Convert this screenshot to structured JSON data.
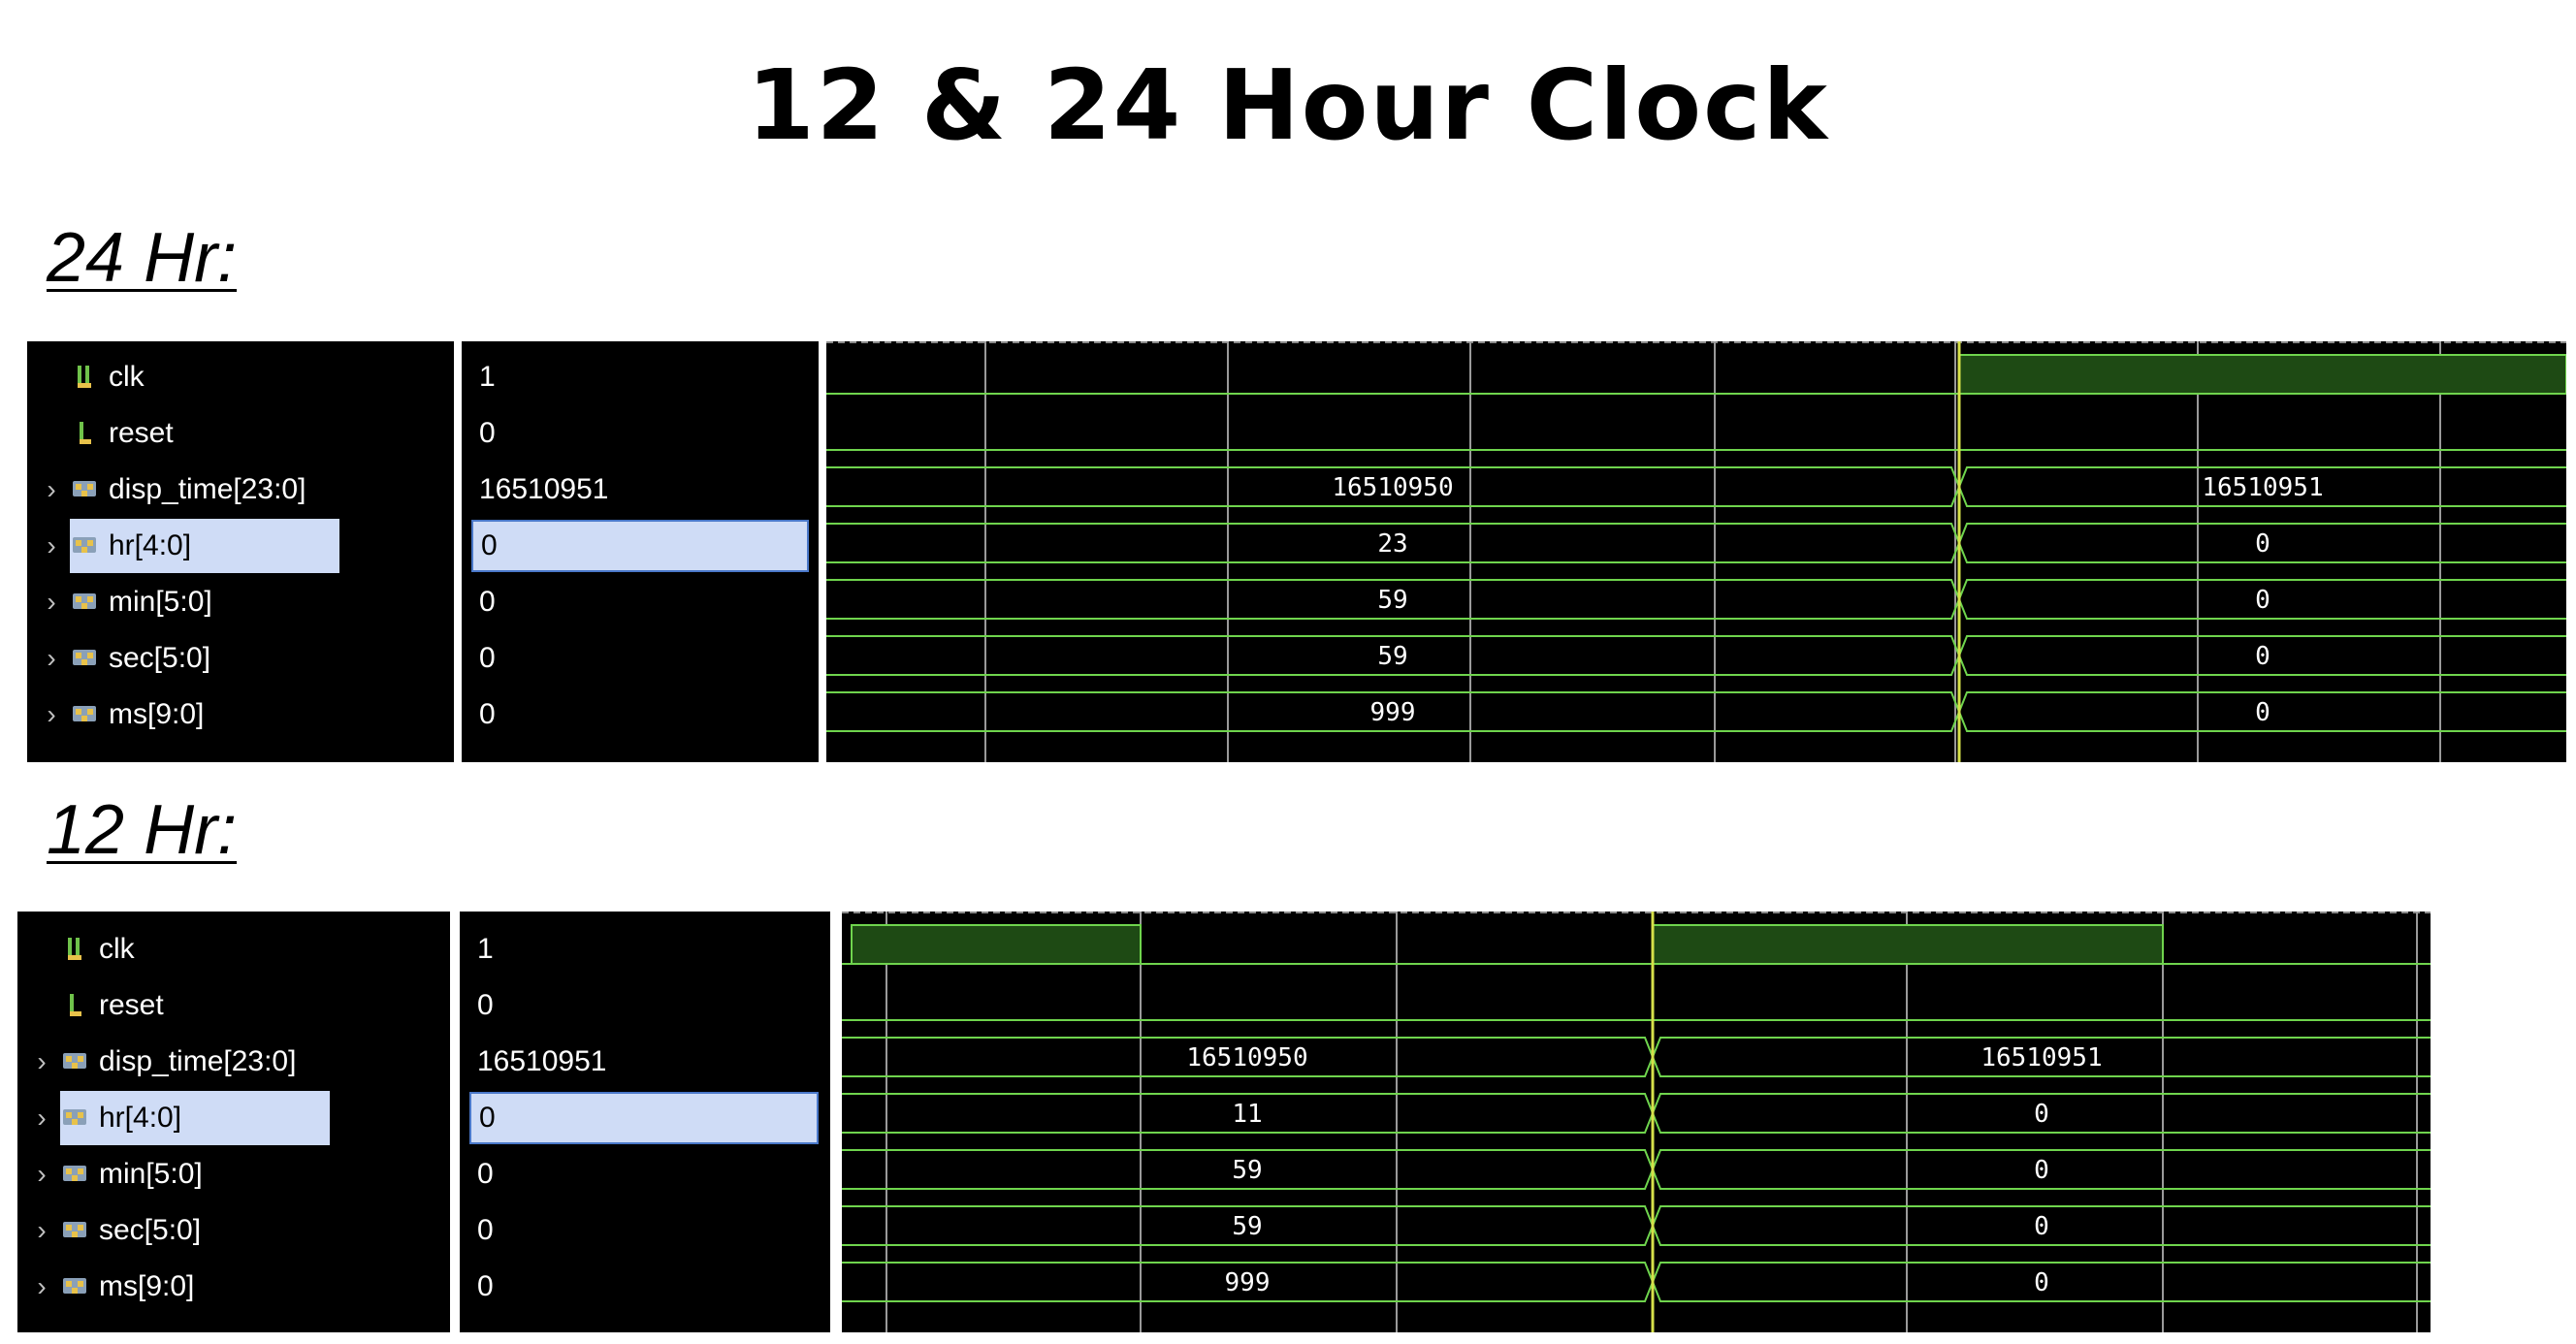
{
  "title": "12 & 24 Hour Clock",
  "colors": {
    "wave": "#6fd44d",
    "fill": "#1e4a14",
    "cursor": "#d6e04a",
    "grid": "#9a9a9a",
    "select": "#cfdcf6"
  },
  "sections": [
    {
      "label": "24 Hr:",
      "signals": [
        {
          "name": "clk",
          "value": "1",
          "icon": "clock-bit-icon",
          "expandable": false
        },
        {
          "name": "reset",
          "value": "0",
          "icon": "bit-icon",
          "expandable": false
        },
        {
          "name": "disp_time[23:0]",
          "value": "16510951",
          "icon": "bus-icon",
          "expandable": true,
          "before": "16510950",
          "after": "16510951"
        },
        {
          "name": "hr[4:0]",
          "value": "0",
          "icon": "bus-icon",
          "expandable": true,
          "selected": true,
          "before": "23",
          "after": "0"
        },
        {
          "name": "min[5:0]",
          "value": "0",
          "icon": "bus-icon",
          "expandable": true,
          "before": "59",
          "after": "0"
        },
        {
          "name": "sec[5:0]",
          "value": "0",
          "icon": "bus-icon",
          "expandable": true,
          "before": "59",
          "after": "0"
        },
        {
          "name": "ms[9:0]",
          "value": "0",
          "icon": "bus-icon",
          "expandable": true,
          "before": "999",
          "after": "0"
        }
      ]
    },
    {
      "label": "12 Hr:",
      "signals": [
        {
          "name": "clk",
          "value": "1",
          "icon": "clock-bit-icon",
          "expandable": false
        },
        {
          "name": "reset",
          "value": "0",
          "icon": "bit-icon",
          "expandable": false
        },
        {
          "name": "disp_time[23:0]",
          "value": "16510951",
          "icon": "bus-icon",
          "expandable": true,
          "before": "16510950",
          "after": "16510951"
        },
        {
          "name": "hr[4:0]",
          "value": "0",
          "icon": "bus-icon",
          "expandable": true,
          "selected": true,
          "before": "11",
          "after": "0"
        },
        {
          "name": "min[5:0]",
          "value": "0",
          "icon": "bus-icon",
          "expandable": true,
          "before": "59",
          "after": "0"
        },
        {
          "name": "sec[5:0]",
          "value": "0",
          "icon": "bus-icon",
          "expandable": true,
          "before": "59",
          "after": "0"
        },
        {
          "name": "ms[9:0]",
          "value": "0",
          "icon": "bus-icon",
          "expandable": true,
          "before": "999",
          "after": "0"
        }
      ]
    }
  ]
}
